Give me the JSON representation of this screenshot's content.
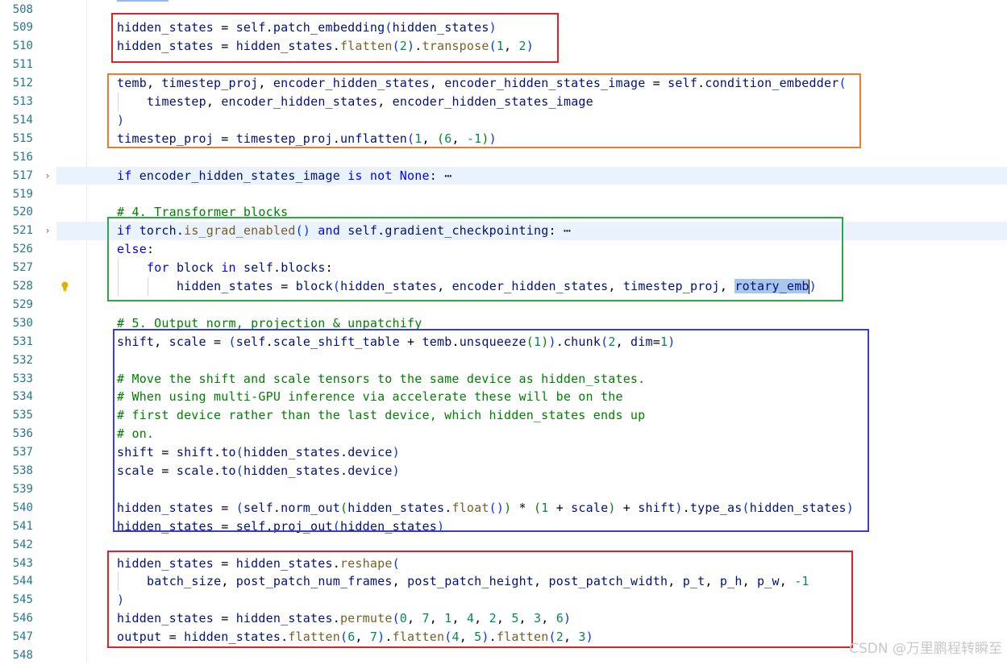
{
  "theme": {
    "background": "#ffffff",
    "line_number": "#237893",
    "keyword": "#0000ff",
    "comment": "#008000",
    "function": "#795e26",
    "number": "#098658",
    "variable": "#001080",
    "highlight": "#eaf3fd",
    "selection": "#a8c7ea"
  },
  "annotation_boxes": [
    {
      "color": "#e0202a",
      "lines": "509-510"
    },
    {
      "color": "#f07a2a",
      "lines": "512-515"
    },
    {
      "color": "#2aa84a",
      "lines": "521-528"
    },
    {
      "color": "#3a3ec8",
      "lines": "531-541"
    },
    {
      "color": "#e0202a",
      "lines": "543-547"
    }
  ],
  "lines": [
    {
      "num": "508",
      "tokens": []
    },
    {
      "num": "509",
      "tokens": [
        [
          "v",
          "hidden_states"
        ],
        [
          "d",
          " = "
        ],
        [
          "v",
          "self"
        ],
        [
          "d",
          "."
        ],
        [
          "v",
          "patch_embedding"
        ],
        [
          "p",
          "("
        ],
        [
          "v",
          "hidden_states"
        ],
        [
          "p",
          ")"
        ]
      ]
    },
    {
      "num": "510",
      "tokens": [
        [
          "v",
          "hidden_states"
        ],
        [
          "d",
          " = "
        ],
        [
          "v",
          "hidden_states"
        ],
        [
          "d",
          "."
        ],
        [
          "f",
          "flatten"
        ],
        [
          "p",
          "("
        ],
        [
          "n",
          "2"
        ],
        [
          "p",
          ")"
        ],
        [
          "d",
          "."
        ],
        [
          "f",
          "transpose"
        ],
        [
          "p",
          "("
        ],
        [
          "n",
          "1"
        ],
        [
          "d",
          ", "
        ],
        [
          "n",
          "2"
        ],
        [
          "p",
          ")"
        ]
      ]
    },
    {
      "num": "511",
      "tokens": []
    },
    {
      "num": "512",
      "tokens": [
        [
          "v",
          "temb"
        ],
        [
          "d",
          ", "
        ],
        [
          "v",
          "timestep_proj"
        ],
        [
          "d",
          ", "
        ],
        [
          "v",
          "encoder_hidden_states"
        ],
        [
          "d",
          ", "
        ],
        [
          "v",
          "encoder_hidden_states_image"
        ],
        [
          "d",
          " = "
        ],
        [
          "v",
          "self"
        ],
        [
          "d",
          "."
        ],
        [
          "v",
          "condition_embedder"
        ],
        [
          "p",
          "("
        ]
      ]
    },
    {
      "num": "513",
      "indent": 1,
      "tokens": [
        [
          "v",
          "timestep"
        ],
        [
          "d",
          ", "
        ],
        [
          "v",
          "encoder_hidden_states"
        ],
        [
          "d",
          ", "
        ],
        [
          "v",
          "encoder_hidden_states_image"
        ]
      ]
    },
    {
      "num": "514",
      "tokens": [
        [
          "p",
          ")"
        ]
      ]
    },
    {
      "num": "515",
      "tokens": [
        [
          "v",
          "timestep_proj"
        ],
        [
          "d",
          " = "
        ],
        [
          "v",
          "timestep_proj"
        ],
        [
          "d",
          "."
        ],
        [
          "v",
          "unflatten"
        ],
        [
          "p",
          "("
        ],
        [
          "n",
          "1"
        ],
        [
          "d",
          ", "
        ],
        [
          "c",
          "("
        ],
        [
          "n",
          "6"
        ],
        [
          "d",
          ", "
        ],
        [
          "n",
          "-1"
        ],
        [
          "c",
          ")"
        ],
        [
          "p",
          ")"
        ]
      ]
    },
    {
      "num": "516",
      "tokens": []
    },
    {
      "num": "517",
      "fold": "›",
      "highlight": true,
      "tokens": [
        [
          "k",
          "if "
        ],
        [
          "v",
          "encoder_hidden_states_image"
        ],
        [
          "d",
          " "
        ],
        [
          "k",
          "is not "
        ],
        [
          "k",
          "None"
        ],
        [
          "d",
          ":"
        ],
        [
          "d",
          " ⋯"
        ]
      ]
    },
    {
      "num": "519",
      "tokens": []
    },
    {
      "num": "520",
      "tokens": [
        [
          "c",
          "# 4. Transformer blocks"
        ]
      ]
    },
    {
      "num": "521",
      "fold": "›",
      "highlight": true,
      "tokens": [
        [
          "k",
          "if "
        ],
        [
          "v",
          "torch"
        ],
        [
          "d",
          "."
        ],
        [
          "f",
          "is_grad_enabled"
        ],
        [
          "p",
          "()"
        ],
        [
          "d",
          " "
        ],
        [
          "k",
          "and "
        ],
        [
          "v",
          "self"
        ],
        [
          "d",
          "."
        ],
        [
          "v",
          "gradient_checkpointing"
        ],
        [
          "d",
          ":"
        ],
        [
          "d",
          " ⋯"
        ]
      ]
    },
    {
      "num": "526",
      "tokens": [
        [
          "k",
          "else"
        ],
        [
          "d",
          ":"
        ]
      ]
    },
    {
      "num": "527",
      "indent": 1,
      "tokens": [
        [
          "k",
          "for "
        ],
        [
          "v",
          "block"
        ],
        [
          "d",
          " "
        ],
        [
          "k",
          "in "
        ],
        [
          "v",
          "self"
        ],
        [
          "d",
          "."
        ],
        [
          "v",
          "blocks"
        ],
        [
          "d",
          ":"
        ]
      ]
    },
    {
      "num": "528",
      "indent": 2,
      "bulb": true,
      "tokens": [
        [
          "v",
          "hidden_states"
        ],
        [
          "d",
          " = "
        ],
        [
          "v",
          "block"
        ],
        [
          "p",
          "("
        ],
        [
          "v",
          "hidden_states"
        ],
        [
          "d",
          ", "
        ],
        [
          "v",
          "encoder_hidden_states"
        ],
        [
          "d",
          ", "
        ],
        [
          "v",
          "timestep_proj"
        ],
        [
          "d",
          ", "
        ],
        [
          "sel",
          "rotary_emb"
        ],
        [
          "cursor",
          ""
        ],
        [
          "p",
          ")"
        ]
      ]
    },
    {
      "num": "529",
      "tokens": []
    },
    {
      "num": "530",
      "tokens": [
        [
          "c",
          "# 5. Output norm, projection & unpatchify"
        ]
      ]
    },
    {
      "num": "531",
      "tokens": [
        [
          "v",
          "shift"
        ],
        [
          "d",
          ", "
        ],
        [
          "v",
          "scale"
        ],
        [
          "d",
          " = "
        ],
        [
          "p",
          "("
        ],
        [
          "v",
          "self"
        ],
        [
          "d",
          "."
        ],
        [
          "v",
          "scale_shift_table"
        ],
        [
          "d",
          " + "
        ],
        [
          "v",
          "temb"
        ],
        [
          "d",
          "."
        ],
        [
          "v",
          "unsqueeze"
        ],
        [
          "c",
          "("
        ],
        [
          "n",
          "1"
        ],
        [
          "c",
          ")"
        ],
        [
          "p",
          ")"
        ],
        [
          "d",
          "."
        ],
        [
          "v",
          "chunk"
        ],
        [
          "p",
          "("
        ],
        [
          "n",
          "2"
        ],
        [
          "d",
          ", "
        ],
        [
          "v",
          "dim"
        ],
        [
          "d",
          "="
        ],
        [
          "n",
          "1"
        ],
        [
          "p",
          ")"
        ]
      ]
    },
    {
      "num": "532",
      "tokens": []
    },
    {
      "num": "533",
      "tokens": [
        [
          "c",
          "# Move the shift and scale tensors to the same device as hidden_states."
        ]
      ]
    },
    {
      "num": "534",
      "tokens": [
        [
          "c",
          "# When using multi-GPU inference via accelerate these will be on the"
        ]
      ]
    },
    {
      "num": "535",
      "tokens": [
        [
          "c",
          "# first device rather than the last device, which hidden_states ends up"
        ]
      ]
    },
    {
      "num": "536",
      "tokens": [
        [
          "c",
          "# on."
        ]
      ]
    },
    {
      "num": "537",
      "tokens": [
        [
          "v",
          "shift"
        ],
        [
          "d",
          " = "
        ],
        [
          "v",
          "shift"
        ],
        [
          "d",
          "."
        ],
        [
          "v",
          "to"
        ],
        [
          "p",
          "("
        ],
        [
          "v",
          "hidden_states"
        ],
        [
          "d",
          "."
        ],
        [
          "v",
          "device"
        ],
        [
          "p",
          ")"
        ]
      ]
    },
    {
      "num": "538",
      "tokens": [
        [
          "v",
          "scale"
        ],
        [
          "d",
          " = "
        ],
        [
          "v",
          "scale"
        ],
        [
          "d",
          "."
        ],
        [
          "v",
          "to"
        ],
        [
          "p",
          "("
        ],
        [
          "v",
          "hidden_states"
        ],
        [
          "d",
          "."
        ],
        [
          "v",
          "device"
        ],
        [
          "p",
          ")"
        ]
      ]
    },
    {
      "num": "539",
      "tokens": []
    },
    {
      "num": "540",
      "tokens": [
        [
          "v",
          "hidden_states"
        ],
        [
          "d",
          " = "
        ],
        [
          "p",
          "("
        ],
        [
          "v",
          "self"
        ],
        [
          "d",
          "."
        ],
        [
          "v",
          "norm_out"
        ],
        [
          "c",
          "("
        ],
        [
          "v",
          "hidden_states"
        ],
        [
          "d",
          "."
        ],
        [
          "f",
          "float"
        ],
        [
          "p",
          "()"
        ],
        [
          "c",
          ")"
        ],
        [
          "d",
          " * "
        ],
        [
          "c",
          "("
        ],
        [
          "n",
          "1"
        ],
        [
          "d",
          " + "
        ],
        [
          "v",
          "scale"
        ],
        [
          "c",
          ")"
        ],
        [
          "d",
          " + "
        ],
        [
          "v",
          "shift"
        ],
        [
          "p",
          ")"
        ],
        [
          "d",
          "."
        ],
        [
          "v",
          "type_as"
        ],
        [
          "p",
          "("
        ],
        [
          "v",
          "hidden_states"
        ],
        [
          "p",
          ")"
        ]
      ]
    },
    {
      "num": "541",
      "tokens": [
        [
          "v",
          "hidden_states"
        ],
        [
          "d",
          " = "
        ],
        [
          "v",
          "self"
        ],
        [
          "d",
          "."
        ],
        [
          "v",
          "proj_out"
        ],
        [
          "p",
          "("
        ],
        [
          "v",
          "hidden_states"
        ],
        [
          "p",
          ")"
        ]
      ]
    },
    {
      "num": "542",
      "tokens": []
    },
    {
      "num": "543",
      "tokens": [
        [
          "v",
          "hidden_states"
        ],
        [
          "d",
          " = "
        ],
        [
          "v",
          "hidden_states"
        ],
        [
          "d",
          "."
        ],
        [
          "f",
          "reshape"
        ],
        [
          "p",
          "("
        ]
      ]
    },
    {
      "num": "544",
      "indent": 1,
      "tokens": [
        [
          "v",
          "batch_size"
        ],
        [
          "d",
          ", "
        ],
        [
          "v",
          "post_patch_num_frames"
        ],
        [
          "d",
          ", "
        ],
        [
          "v",
          "post_patch_height"
        ],
        [
          "d",
          ", "
        ],
        [
          "v",
          "post_patch_width"
        ],
        [
          "d",
          ", "
        ],
        [
          "v",
          "p_t"
        ],
        [
          "d",
          ", "
        ],
        [
          "v",
          "p_h"
        ],
        [
          "d",
          ", "
        ],
        [
          "v",
          "p_w"
        ],
        [
          "d",
          ", "
        ],
        [
          "n",
          "-1"
        ]
      ]
    },
    {
      "num": "545",
      "tokens": [
        [
          "p",
          ")"
        ]
      ]
    },
    {
      "num": "546",
      "tokens": [
        [
          "v",
          "hidden_states"
        ],
        [
          "d",
          " = "
        ],
        [
          "v",
          "hidden_states"
        ],
        [
          "d",
          "."
        ],
        [
          "f",
          "permute"
        ],
        [
          "p",
          "("
        ],
        [
          "n",
          "0"
        ],
        [
          "d",
          ", "
        ],
        [
          "n",
          "7"
        ],
        [
          "d",
          ", "
        ],
        [
          "n",
          "1"
        ],
        [
          "d",
          ", "
        ],
        [
          "n",
          "4"
        ],
        [
          "d",
          ", "
        ],
        [
          "n",
          "2"
        ],
        [
          "d",
          ", "
        ],
        [
          "n",
          "5"
        ],
        [
          "d",
          ", "
        ],
        [
          "n",
          "3"
        ],
        [
          "d",
          ", "
        ],
        [
          "n",
          "6"
        ],
        [
          "p",
          ")"
        ]
      ]
    },
    {
      "num": "547",
      "tokens": [
        [
          "v",
          "output"
        ],
        [
          "d",
          " = "
        ],
        [
          "v",
          "hidden_states"
        ],
        [
          "d",
          "."
        ],
        [
          "f",
          "flatten"
        ],
        [
          "p",
          "("
        ],
        [
          "n",
          "6"
        ],
        [
          "d",
          ", "
        ],
        [
          "n",
          "7"
        ],
        [
          "p",
          ")"
        ],
        [
          "d",
          "."
        ],
        [
          "f",
          "flatten"
        ],
        [
          "p",
          "("
        ],
        [
          "n",
          "4"
        ],
        [
          "d",
          ", "
        ],
        [
          "n",
          "5"
        ],
        [
          "p",
          ")"
        ],
        [
          "d",
          "."
        ],
        [
          "f",
          "flatten"
        ],
        [
          "p",
          "("
        ],
        [
          "n",
          "2"
        ],
        [
          "d",
          ", "
        ],
        [
          "n",
          "3"
        ],
        [
          "p",
          ")"
        ]
      ]
    },
    {
      "num": "548",
      "tokens": []
    }
  ],
  "watermark": "CSDN @万里鹏程转瞬至"
}
